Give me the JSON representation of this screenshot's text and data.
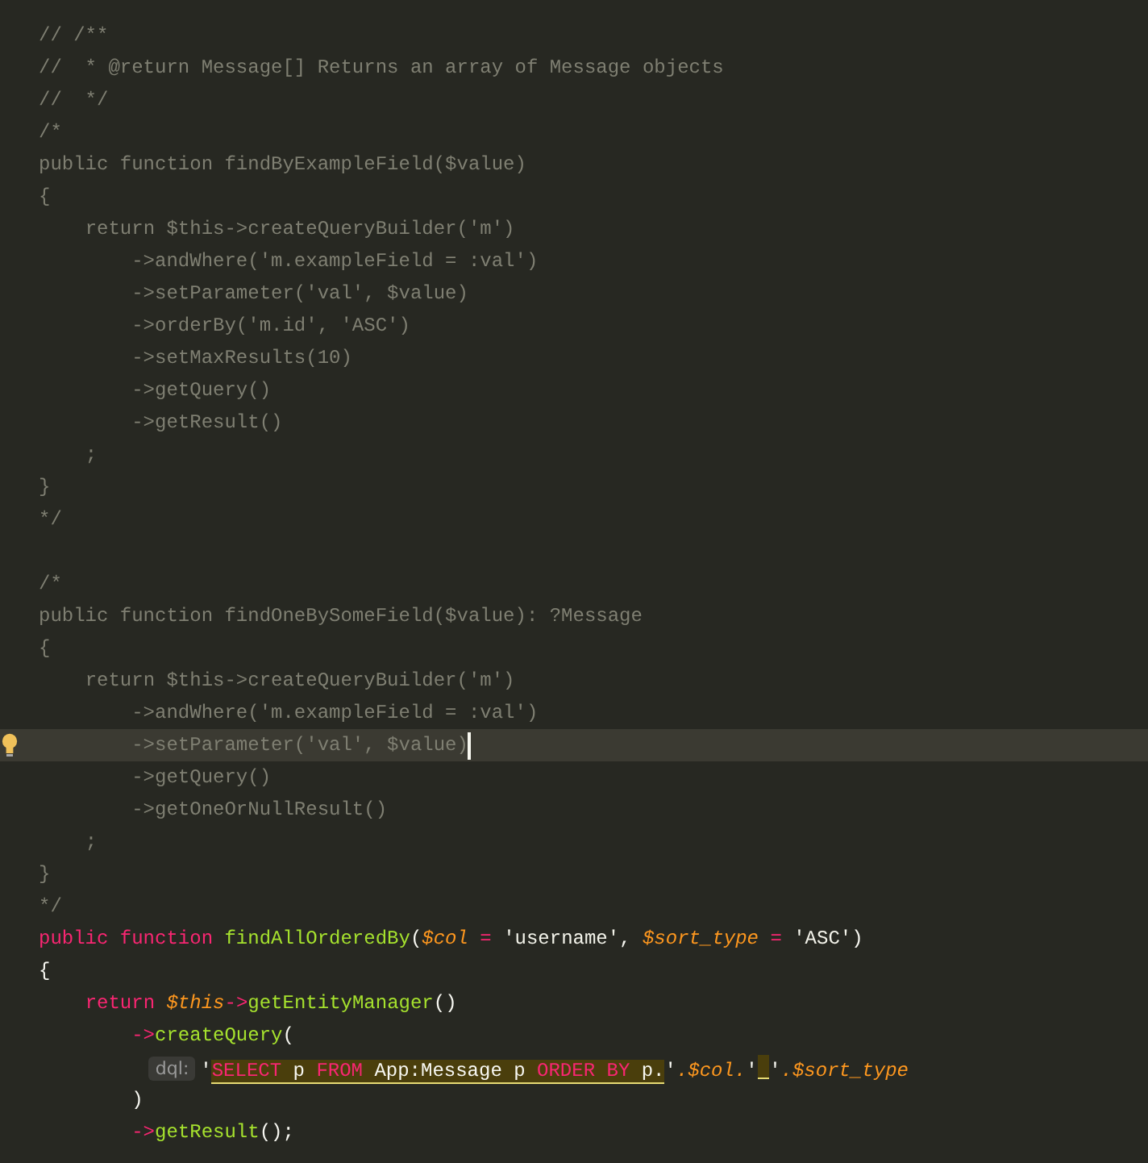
{
  "editor": {
    "lines": [
      {
        "current": false,
        "tokens": [
          {
            "kind": "comment",
            "t": "// /**"
          }
        ]
      },
      {
        "current": false,
        "tokens": [
          {
            "kind": "comment",
            "t": "//  * @return Message[] Returns an array of Message objects"
          }
        ]
      },
      {
        "current": false,
        "tokens": [
          {
            "kind": "comment",
            "t": "//  */"
          }
        ]
      },
      {
        "current": false,
        "tokens": [
          {
            "kind": "comment",
            "t": "/*"
          }
        ]
      },
      {
        "current": false,
        "tokens": [
          {
            "kind": "comment",
            "t": "public function findByExampleField($value)"
          }
        ]
      },
      {
        "current": false,
        "tokens": [
          {
            "kind": "comment",
            "t": "{"
          }
        ]
      },
      {
        "current": false,
        "tokens": [
          {
            "kind": "comment",
            "t": "    return $this->createQueryBuilder('m')"
          }
        ]
      },
      {
        "current": false,
        "tokens": [
          {
            "kind": "comment",
            "t": "        ->andWhere('m.exampleField = :val')"
          }
        ]
      },
      {
        "current": false,
        "tokens": [
          {
            "kind": "comment",
            "t": "        ->setParameter('val', $value)"
          }
        ]
      },
      {
        "current": false,
        "tokens": [
          {
            "kind": "comment",
            "t": "        ->orderBy('m.id', 'ASC')"
          }
        ]
      },
      {
        "current": false,
        "tokens": [
          {
            "kind": "comment",
            "t": "        ->setMaxResults(10)"
          }
        ]
      },
      {
        "current": false,
        "tokens": [
          {
            "kind": "comment",
            "t": "        ->getQuery()"
          }
        ]
      },
      {
        "current": false,
        "tokens": [
          {
            "kind": "comment",
            "t": "        ->getResult()"
          }
        ]
      },
      {
        "current": false,
        "tokens": [
          {
            "kind": "comment",
            "t": "    ;"
          }
        ]
      },
      {
        "current": false,
        "tokens": [
          {
            "kind": "comment",
            "t": "}"
          }
        ]
      },
      {
        "current": false,
        "tokens": [
          {
            "kind": "comment",
            "t": "*/"
          }
        ]
      },
      {
        "current": false
      },
      {
        "current": false,
        "tokens": [
          {
            "kind": "comment",
            "t": "/*"
          }
        ]
      },
      {
        "current": false,
        "tokens": [
          {
            "kind": "comment",
            "t": "public function findOneBySomeField($value): ?Message"
          }
        ]
      },
      {
        "current": false,
        "tokens": [
          {
            "kind": "comment",
            "t": "{"
          }
        ]
      },
      {
        "current": false,
        "tokens": [
          {
            "kind": "comment",
            "t": "    return $this->createQueryBuilder('m')"
          }
        ]
      },
      {
        "current": false,
        "tokens": [
          {
            "kind": "comment",
            "t": "        ->andWhere('m.exampleField = :val')"
          }
        ]
      },
      {
        "current": true,
        "tokens": [
          {
            "kind": "comment",
            "t": "        ->setParameter('val', $value)"
          }
        ]
      },
      {
        "current": false,
        "tokens": [
          {
            "kind": "comment",
            "t": "        ->getQuery()"
          }
        ]
      },
      {
        "current": false,
        "tokens": [
          {
            "kind": "comment",
            "t": "        ->getOneOrNullResult()"
          }
        ]
      },
      {
        "current": false,
        "tokens": [
          {
            "kind": "comment",
            "t": "    ;"
          }
        ]
      },
      {
        "current": false,
        "tokens": [
          {
            "kind": "comment",
            "t": "}"
          }
        ]
      },
      {
        "current": false,
        "tokens": [
          {
            "kind": "comment",
            "t": "*/"
          }
        ]
      },
      {
        "current": false,
        "tokens": [
          {
            "kind": "keyword",
            "t": "public function "
          },
          {
            "kind": "func",
            "t": "findAllOrderedBy"
          },
          {
            "kind": "plain",
            "t": "("
          },
          {
            "kind": "var",
            "t": "$col "
          },
          {
            "kind": "keyword",
            "t": "= "
          },
          {
            "kind": "string",
            "t": "'username'"
          },
          {
            "kind": "plain",
            "t": ", "
          },
          {
            "kind": "var",
            "t": "$sort_type "
          },
          {
            "kind": "keyword",
            "t": "= "
          },
          {
            "kind": "string",
            "t": "'ASC'"
          },
          {
            "kind": "plain",
            "t": ")"
          }
        ]
      },
      {
        "current": false,
        "tokens": [
          {
            "kind": "plain",
            "t": "{"
          }
        ]
      },
      {
        "current": false,
        "tokens": [
          {
            "kind": "keyword",
            "t": "    return "
          },
          {
            "kind": "var",
            "t": "$this"
          },
          {
            "kind": "keyword",
            "t": "->"
          },
          {
            "kind": "func",
            "t": "getEntityManager"
          },
          {
            "kind": "plain",
            "t": "()"
          }
        ]
      },
      {
        "current": false,
        "tokens": [
          {
            "kind": "keyword",
            "t": "        ->"
          },
          {
            "kind": "func",
            "t": "createQuery"
          },
          {
            "kind": "plain",
            "t": "("
          }
        ]
      },
      {
        "current": false,
        "hint": "dql:",
        "tokens": [
          {
            "kind": "plain",
            "t": "            '"
          },
          {
            "kind": "sqlkw",
            "t": "SELECT"
          },
          {
            "kind": "sql",
            "t": " p "
          },
          {
            "kind": "sqlkw",
            "t": "FROM"
          },
          {
            "kind": "sql",
            "t": " App:Message p "
          },
          {
            "kind": "sqlkw",
            "t": "ORDER BY"
          },
          {
            "kind": "sql",
            "t": " p."
          },
          {
            "kind": "plain",
            "t": "'"
          },
          {
            "kind": "var",
            "t": ".$col."
          },
          {
            "kind": "plain",
            "t": "'"
          },
          {
            "kind": "sqlgap"
          },
          {
            "kind": "plain",
            "t": "'"
          },
          {
            "kind": "var",
            "t": ".$sort_type"
          }
        ]
      },
      {
        "current": false,
        "tokens": [
          {
            "kind": "plain",
            "t": "        )"
          }
        ]
      },
      {
        "current": false,
        "tokens": [
          {
            "kind": "keyword",
            "t": "        ->"
          },
          {
            "kind": "func",
            "t": "getResult"
          },
          {
            "kind": "plain",
            "t": "();"
          }
        ]
      }
    ]
  }
}
